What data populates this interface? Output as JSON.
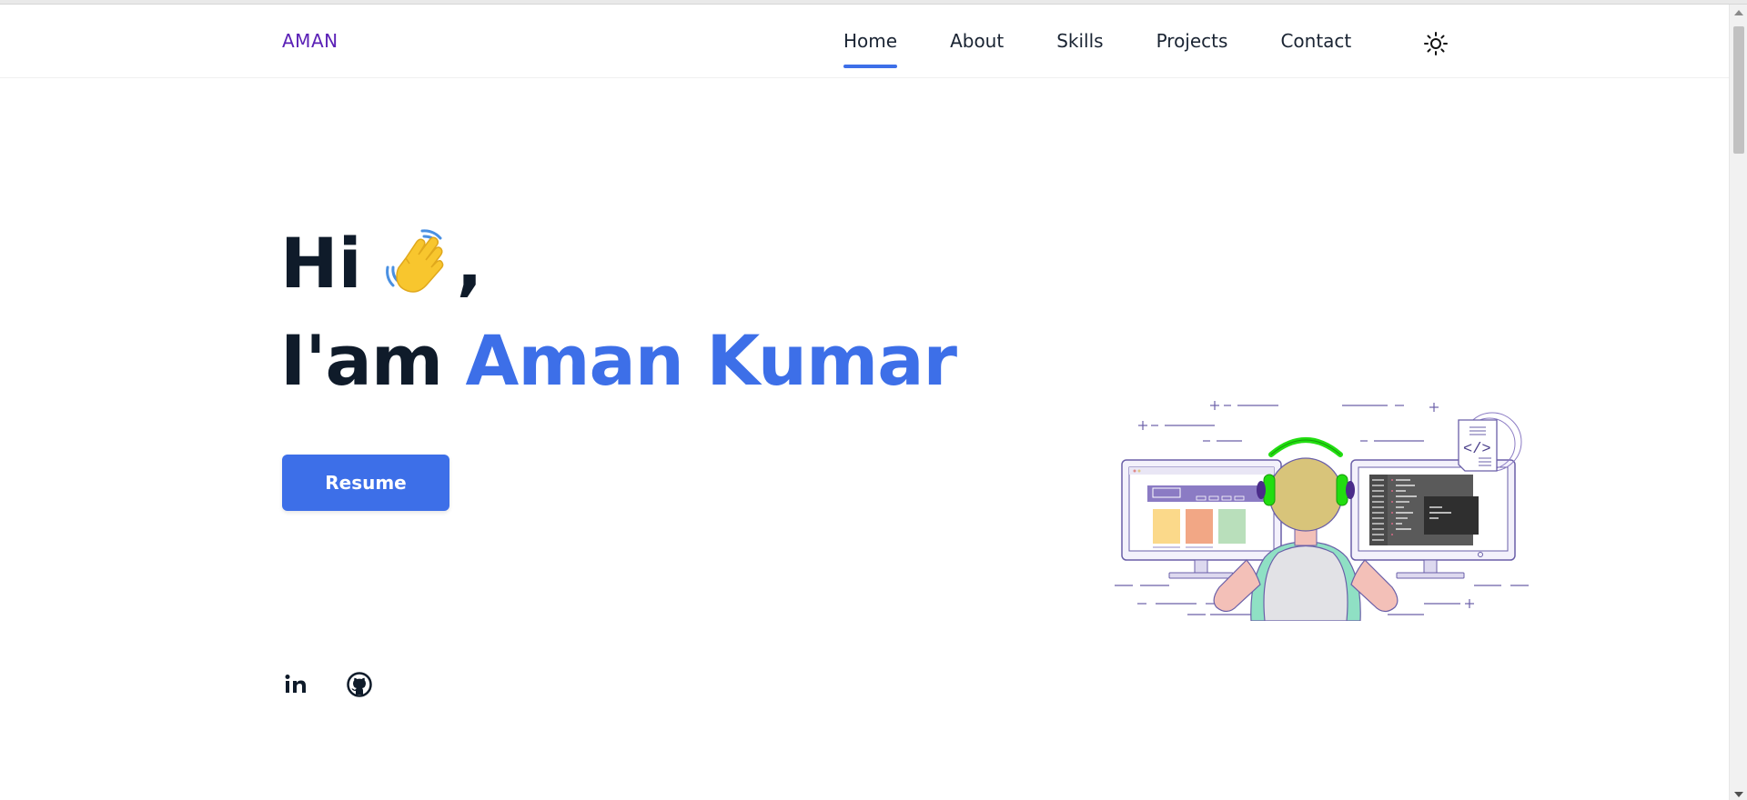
{
  "header": {
    "logo": "AMAN",
    "nav": [
      {
        "label": "Home",
        "active": true
      },
      {
        "label": "About",
        "active": false
      },
      {
        "label": "Skills",
        "active": false
      },
      {
        "label": "Projects",
        "active": false
      },
      {
        "label": "Contact",
        "active": false
      }
    ],
    "theme_toggle_icon": "sun-icon"
  },
  "hero": {
    "greeting": "Hi",
    "greeting_emoji": "waving-hand-icon",
    "greeting_suffix": ",",
    "intro": "I'am",
    "name": "Aman Kumar",
    "resume_label": "Resume"
  },
  "social": [
    {
      "icon": "linkedin-icon"
    },
    {
      "icon": "github-icon"
    }
  ],
  "illustration": "developer-at-monitors-illustration",
  "colors": {
    "accent": "#3d6fe8",
    "logo": "#5b21b6",
    "heading": "#0f1b2a",
    "headphones": "#22dd11"
  }
}
